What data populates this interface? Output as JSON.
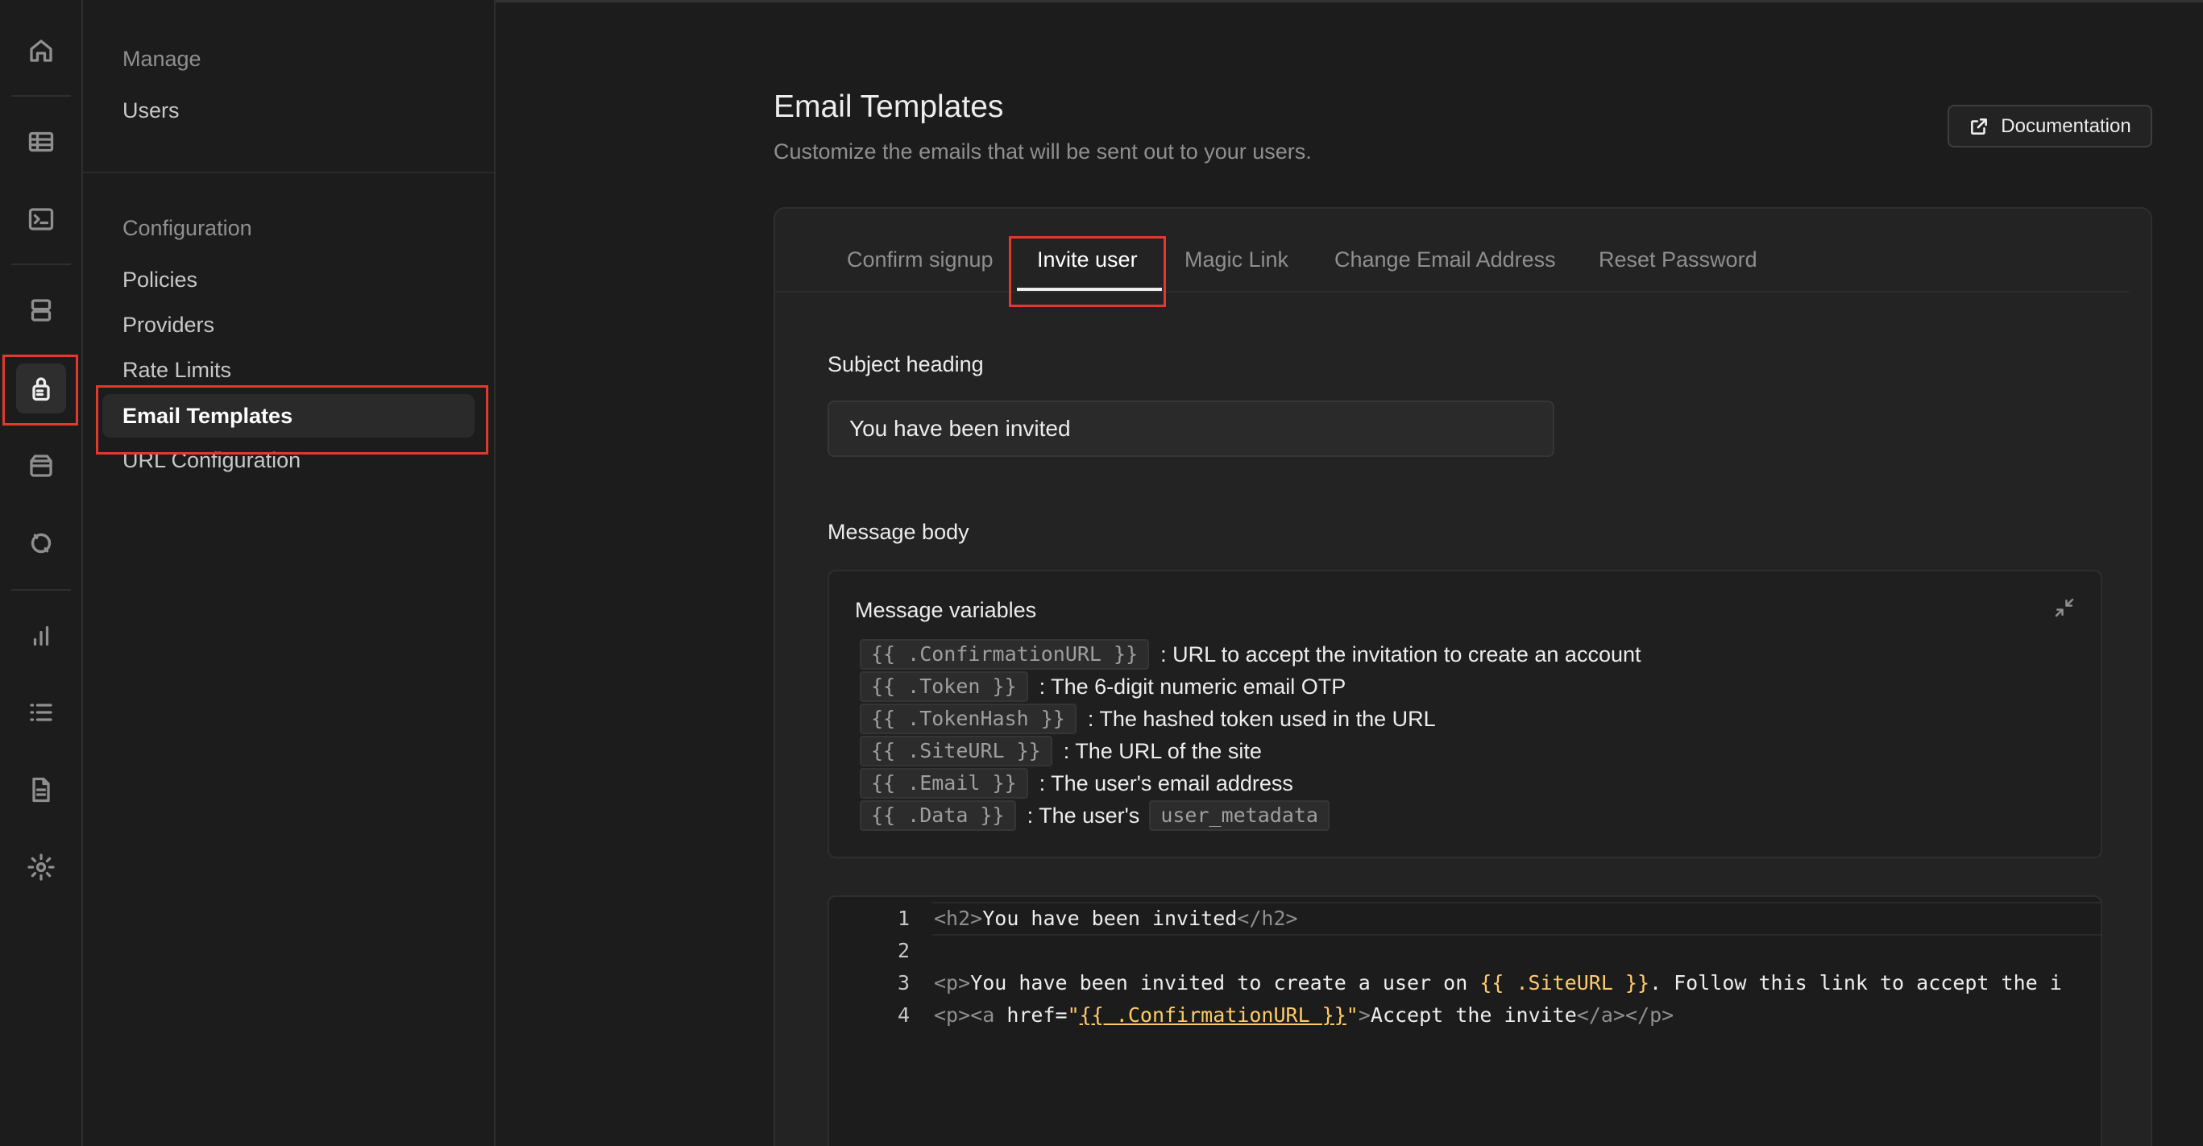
{
  "rail": {
    "icons": [
      "home-icon",
      "table-icon",
      "terminal-icon",
      "database-icon",
      "auth-lock-icon",
      "storage-icon",
      "realtime-icon",
      "reports-icon",
      "logs-icon",
      "docs-icon",
      "settings-icon"
    ]
  },
  "sidebar": {
    "manage_heading": "Manage",
    "manage_items": [
      "Users"
    ],
    "config_heading": "Configuration",
    "config_items": [
      "Policies",
      "Providers",
      "Rate Limits",
      "Email Templates",
      "URL Configuration"
    ]
  },
  "header": {
    "title": "Email Templates",
    "subtitle": "Customize the emails that will be sent out to your users.",
    "doc_button": "Documentation"
  },
  "tabs": [
    "Confirm signup",
    "Invite user",
    "Magic Link",
    "Change Email Address",
    "Reset Password"
  ],
  "form": {
    "subject_label": "Subject heading",
    "subject_value": "You have been invited",
    "body_label": "Message body"
  },
  "variables": {
    "title": "Message variables",
    "items": [
      {
        "code": "{{ .ConfirmationURL }}",
        "desc": ": URL to accept the invitation to create an account"
      },
      {
        "code": "{{ .Token }}",
        "desc": ": The 6-digit numeric email OTP"
      },
      {
        "code": "{{ .TokenHash }}",
        "desc": ": The hashed token used in the URL"
      },
      {
        "code": "{{ .SiteURL }}",
        "desc": ": The URL of the site"
      },
      {
        "code": "{{ .Email }}",
        "desc": ": The user's email address"
      },
      {
        "code": "{{ .Data }}",
        "desc": ": The user's",
        "extra_code": "user_metadata"
      }
    ]
  },
  "editor": {
    "line_numbers": [
      "1",
      "2",
      "3",
      "4"
    ],
    "line1": {
      "open": "<h2>",
      "text": "You have been invited",
      "close": "</h2>"
    },
    "line3": {
      "open": "<p>",
      "text1": "You have been invited to create a user on ",
      "tpl": "{{ .SiteURL }}",
      "text2": ". Follow this link to accept the i"
    },
    "line4": {
      "open": "<p><a ",
      "attr": "href=",
      "q1": "\"",
      "tpl": "{{ .ConfirmationURL }}",
      "q2": "\"",
      "gt": ">",
      "text": "Accept the invite",
      "close": "</a></p>"
    }
  }
}
